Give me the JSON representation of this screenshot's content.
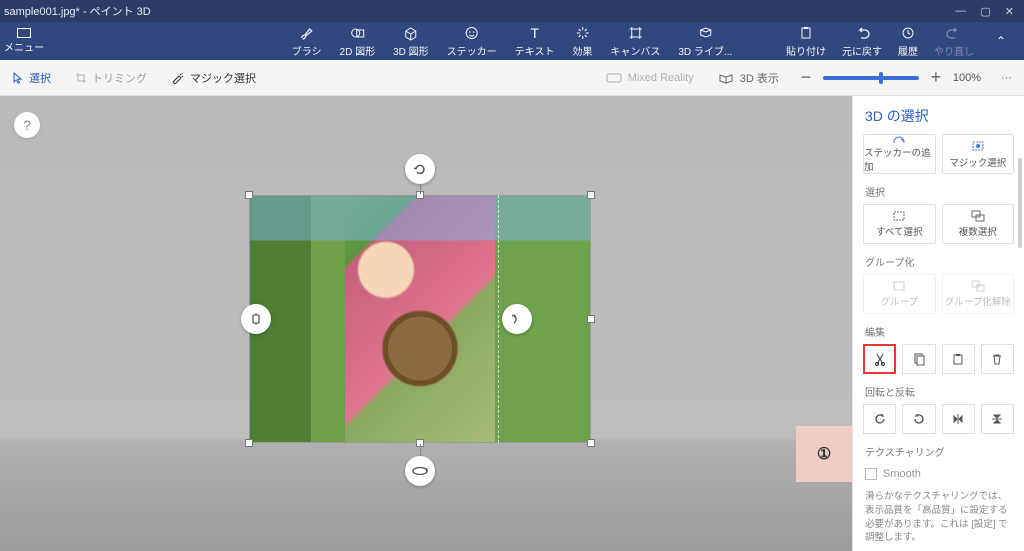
{
  "title": "sample001.jpg* - ペイント 3D",
  "window": {
    "min": "—",
    "max": "▢",
    "close": "✕"
  },
  "menu": "メニュー",
  "ribbon": {
    "brushes": "ブラシ",
    "shapes2d": "2D 図形",
    "shapes3d": "3D 図形",
    "stickers": "ステッカー",
    "text": "テキスト",
    "effects": "効果",
    "canvas": "キャンバス",
    "library3d": "3D ライブ...",
    "paste": "貼り付け",
    "undo": "元に戻す",
    "history": "履歴",
    "redo": "やり直し"
  },
  "toolbar": {
    "select": "選択",
    "crop": "トリミング",
    "magic": "マジック選択",
    "mixed": "Mixed Reality",
    "view3d": "3D 表示",
    "zoom": "100%"
  },
  "callout": "①",
  "panel": {
    "title": "3D の選択",
    "addSticker": "ステッカーの追加",
    "magicSelect": "マジック選択",
    "selectSection": "選択",
    "selectAll": "すべて選択",
    "multiSelect": "複数選択",
    "groupSection": "グループ化",
    "group": "グループ",
    "ungroup": "グループ化解除",
    "editSection": "編集",
    "rotateSection": "回転と反転",
    "textureSection": "テクスチャリング",
    "smooth": "Smooth",
    "note": "滑らかなテクスチャリングでは、表示品質を「高品質」に設定する必要があります。これは [設定] で調整します。"
  }
}
